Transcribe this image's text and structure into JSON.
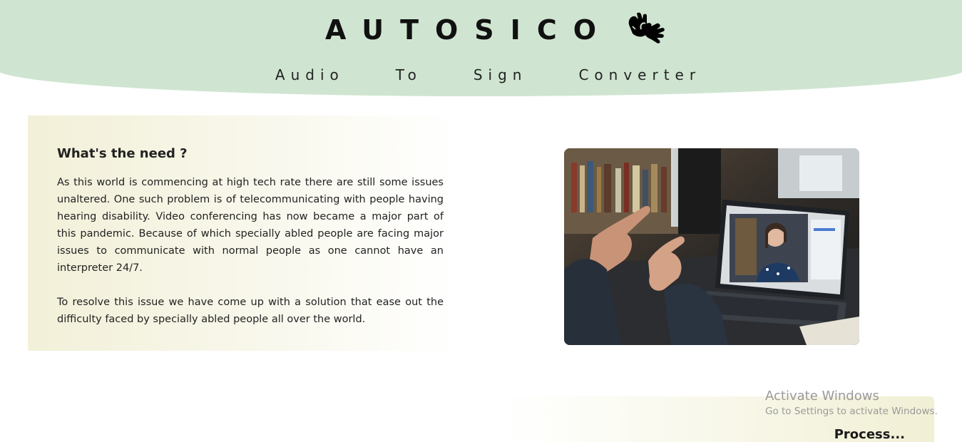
{
  "header": {
    "title": "AUTOSICO",
    "logo_icon": "sign-language-hands-icon",
    "subtitle_words": [
      "Audio",
      "To",
      "Sign",
      "Converter"
    ],
    "background_color": "#cfe5d1"
  },
  "need_section": {
    "heading": "What's the need ?",
    "paragraph_1": "As this world is commencing at high tech rate there are still some issues unaltered. One such problem is of telecommunicating with people having hearing disability. Video conferencing has now became a major part of this pandemic. Because of which specially abled people are facing major issues to communicate with normal people as one cannot have an interpreter 24/7.",
    "paragraph_2": "To resolve this issue we have come up with a solution that ease out the difficulty faced by specially abled people all over the world."
  },
  "photo": {
    "subject": "person-signing-to-laptop-video-call-image"
  },
  "process_section": {
    "label": "Process..."
  },
  "watermark": {
    "title": "Activate Windows",
    "subtitle": "Go to Settings to activate Windows."
  }
}
